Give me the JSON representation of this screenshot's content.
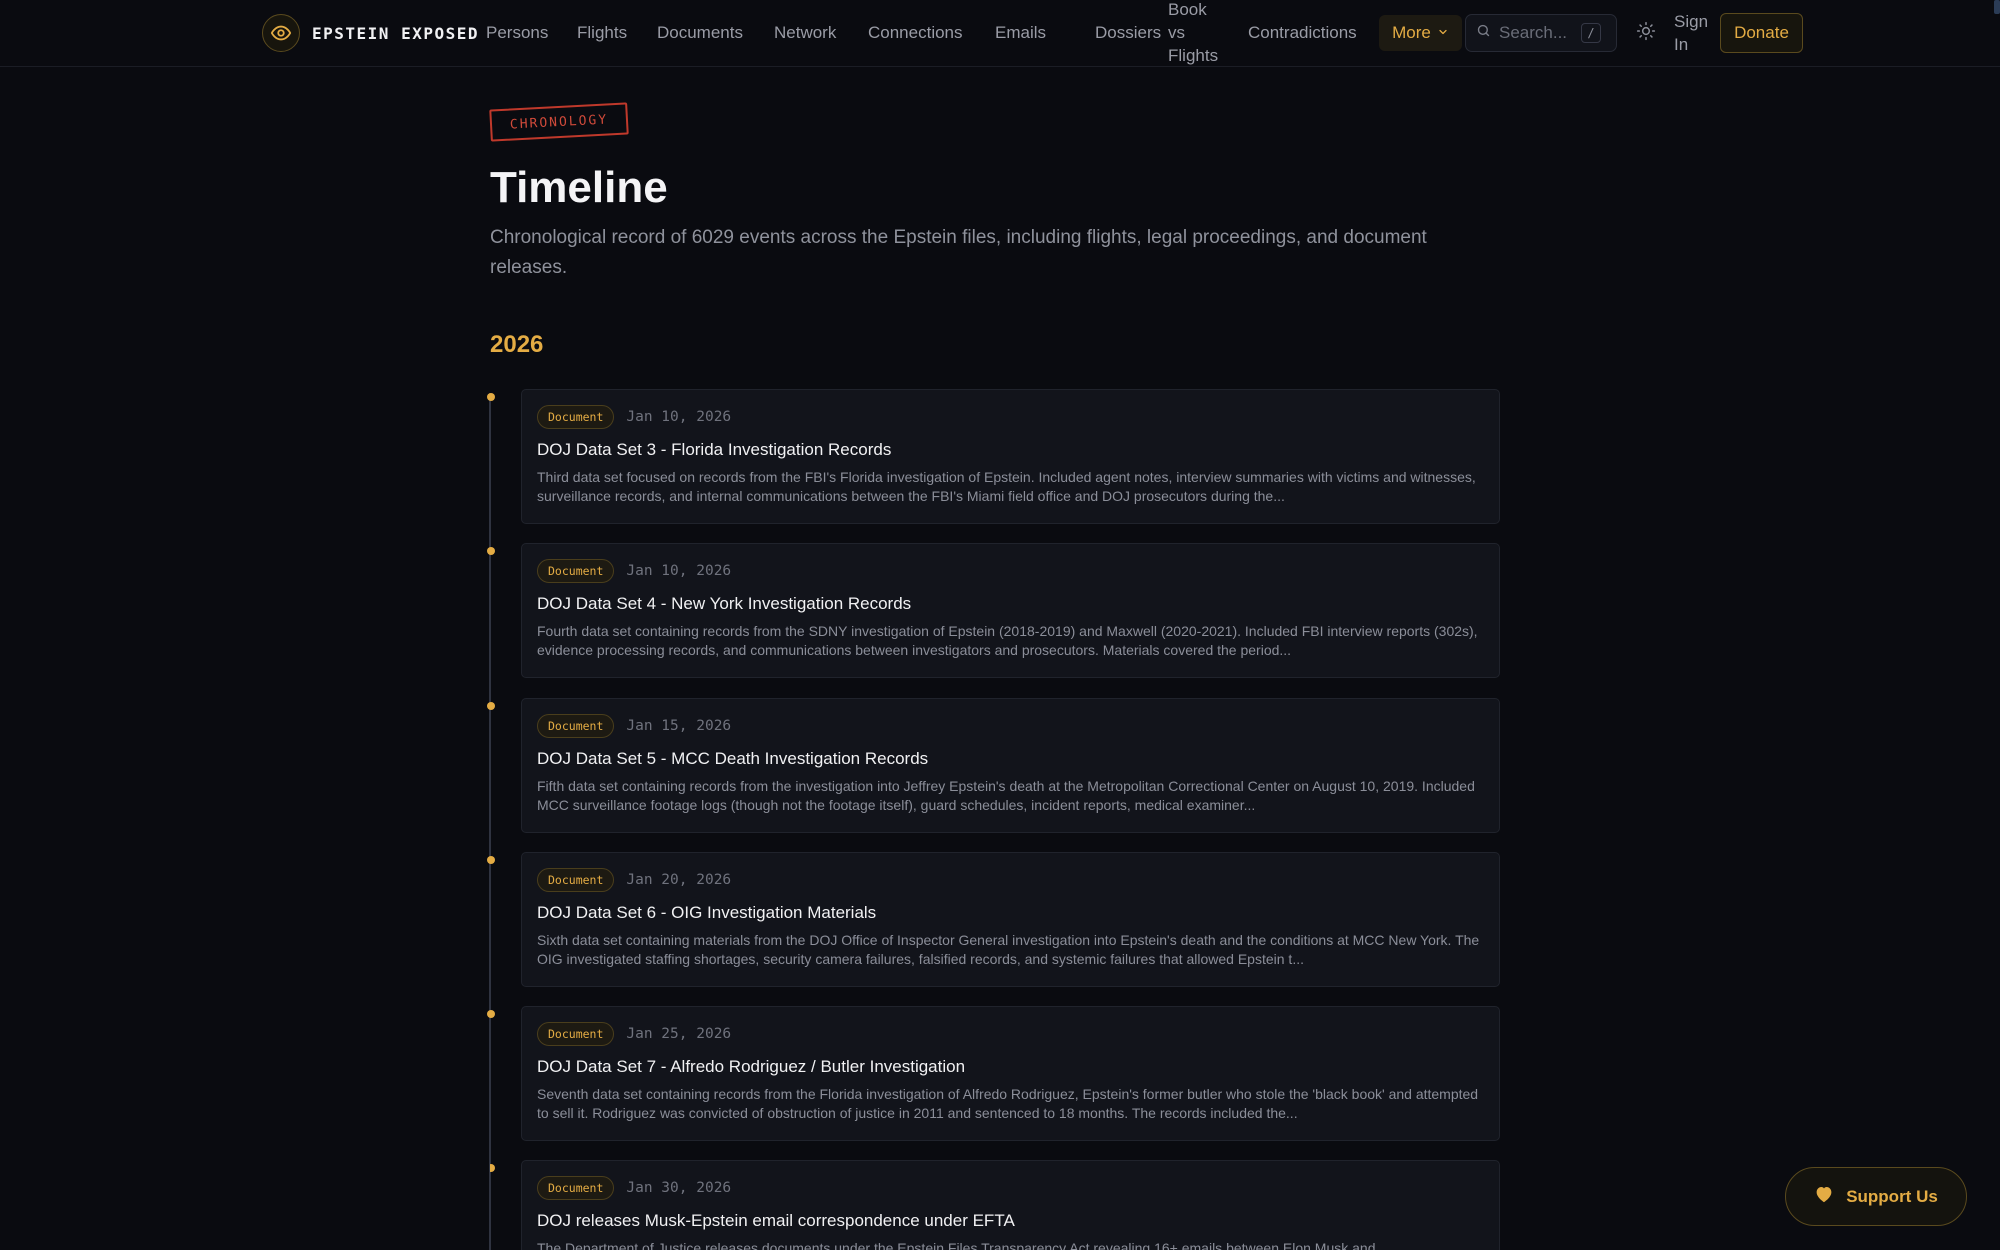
{
  "brand": {
    "name": "EPSTEIN EXPOSED",
    "logo_icon": "eye-icon"
  },
  "nav": {
    "items": [
      {
        "label": "Persons"
      },
      {
        "label": "Flights"
      },
      {
        "label": "Documents"
      },
      {
        "label": "Network"
      },
      {
        "label": "Connections"
      },
      {
        "label": "Emails"
      },
      {
        "label": "Dossiers"
      },
      {
        "label": "Book vs Flights"
      },
      {
        "label": "Contradictions"
      }
    ],
    "more_label": "More",
    "search_placeholder": "Search...",
    "search_shortcut": "/",
    "signin_label": "Sign In",
    "donate_label": "Donate"
  },
  "page": {
    "stamp": "CHRONOLOGY",
    "title": "Timeline",
    "subtitle": "Chronological record of 6029 events across the Epstein files, including flights, legal proceedings, and document releases.",
    "year": "2026"
  },
  "events": [
    {
      "type": "Document",
      "date": "Jan 10, 2026",
      "title": "DOJ Data Set 3 - Florida Investigation Records",
      "description": "Third data set focused on records from the FBI's Florida investigation of Epstein. Included agent notes, interview summaries with victims and witnesses, surveillance records, and internal communications between the FBI's Miami field office and DOJ prosecutors during the..."
    },
    {
      "type": "Document",
      "date": "Jan 10, 2026",
      "title": "DOJ Data Set 4 - New York Investigation Records",
      "description": "Fourth data set containing records from the SDNY investigation of Epstein (2018-2019) and Maxwell (2020-2021). Included FBI interview reports (302s), evidence processing records, and communications between investigators and prosecutors. Materials covered the period..."
    },
    {
      "type": "Document",
      "date": "Jan 15, 2026",
      "title": "DOJ Data Set 5 - MCC Death Investigation Records",
      "description": "Fifth data set containing records from the investigation into Jeffrey Epstein's death at the Metropolitan Correctional Center on August 10, 2019. Included MCC surveillance footage logs (though not the footage itself), guard schedules, incident reports, medical examiner..."
    },
    {
      "type": "Document",
      "date": "Jan 20, 2026",
      "title": "DOJ Data Set 6 - OIG Investigation Materials",
      "description": "Sixth data set containing materials from the DOJ Office of Inspector General investigation into Epstein's death and the conditions at MCC New York. The OIG investigated staffing shortages, security camera failures, falsified records, and systemic failures that allowed Epstein t..."
    },
    {
      "type": "Document",
      "date": "Jan 25, 2026",
      "title": "DOJ Data Set 7 - Alfredo Rodriguez / Butler Investigation",
      "description": "Seventh data set containing records from the Florida investigation of Alfredo Rodriguez, Epstein's former butler who stole the 'black book' and attempted to sell it. Rodriguez was convicted of obstruction of justice in 2011 and sentenced to 18 months. The records included the..."
    },
    {
      "type": "Document",
      "date": "Jan 30, 2026",
      "title": "DOJ releases Musk-Epstein email correspondence under EFTA",
      "description": "The Department of Justice releases documents under the Epstein Files Transparency Act revealing 16+ emails between Elon Musk and"
    }
  ],
  "support": {
    "label": "Support Us",
    "icon": "heart-icon"
  },
  "colors": {
    "accent": "#e4ac44",
    "background": "#0a0b10",
    "card": "#12141b",
    "stamp": "#c0392b"
  }
}
